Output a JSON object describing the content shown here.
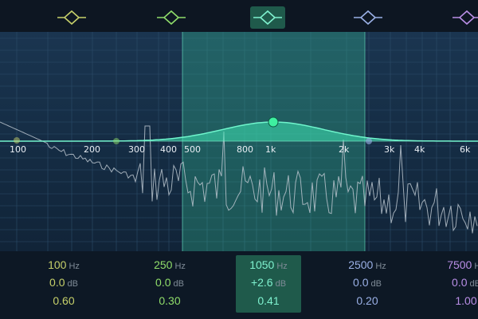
{
  "equalizer": {
    "bands": [
      {
        "id": "band-1",
        "color": "#c6d06a",
        "frequency": "100",
        "freq_unit": "Hz",
        "gain": "0.0",
        "gain_unit": "dB",
        "q": "0.60",
        "icon": "bell-filter-icon",
        "active": false
      },
      {
        "id": "band-2",
        "color": "#8fdc6a",
        "frequency": "250",
        "freq_unit": "Hz",
        "gain": "0.0",
        "gain_unit": "dB",
        "q": "0.30",
        "icon": "bell-filter-icon",
        "active": false
      },
      {
        "id": "band-3",
        "color": "#7ff2cf",
        "frequency": "1050",
        "freq_unit": "Hz",
        "gain": "+2.6",
        "gain_unit": "dB",
        "q": "0.41",
        "icon": "bell-filter-icon",
        "active": true
      },
      {
        "id": "band-4",
        "color": "#9ab0e6",
        "frequency": "2500",
        "freq_unit": "Hz",
        "gain": "0.0",
        "gain_unit": "dB",
        "q": "0.20",
        "icon": "bell-filter-icon",
        "active": false
      },
      {
        "id": "band-5",
        "color": "#b98ee6",
        "frequency": "7500",
        "freq_unit": "Hz",
        "gain": "0.0",
        "gain_unit": "dB",
        "q": "1.00",
        "icon": "bell-filter-icon",
        "active": false
      }
    ],
    "frequency_axis_labels": [
      "100",
      "200",
      "300",
      "400",
      "500",
      "800",
      "1k",
      "2k",
      "3k",
      "4k",
      "6k"
    ],
    "accent_color": "#3ee6b3",
    "background_color": "#132a40"
  }
}
